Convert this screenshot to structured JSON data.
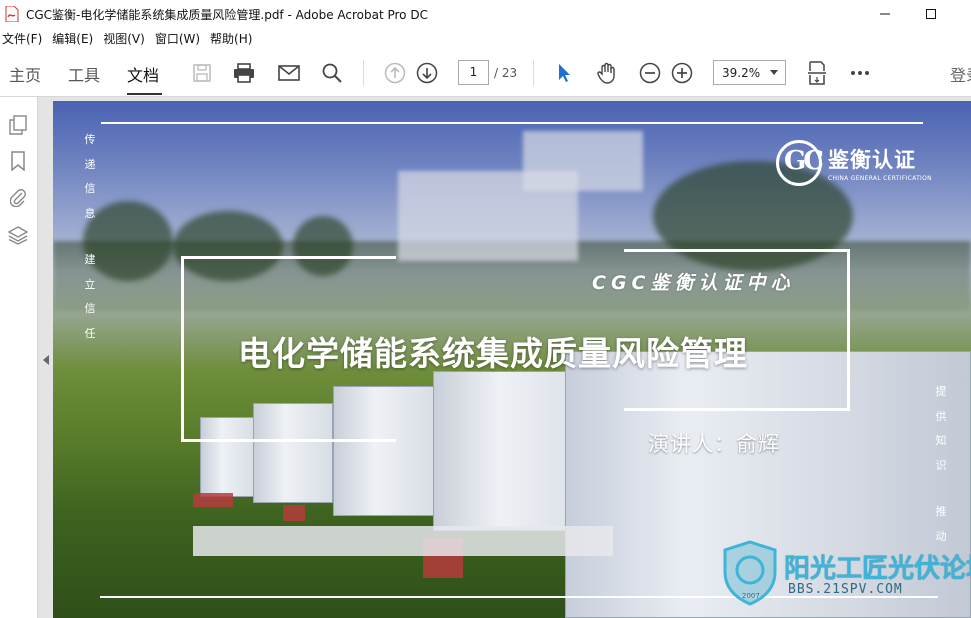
{
  "window": {
    "title": "CGC鉴衡-电化学储能系统集成质量风险管理.pdf - Adobe Acrobat Pro DC"
  },
  "menu": {
    "items": [
      "文件(F)",
      "编辑(E)",
      "视图(V)",
      "窗口(W)",
      "帮助(H)"
    ]
  },
  "toolbar": {
    "tabs": [
      "主页",
      "工具",
      "文档"
    ],
    "active_tab": "文档",
    "page_current": "1",
    "page_total": "/ 23",
    "zoom": "39.2%",
    "signin": "登录",
    "icons": [
      "save-icon",
      "print-icon",
      "email-icon",
      "search-icon",
      "page-up-icon",
      "page-down-icon",
      "select-cursor-icon",
      "hand-icon",
      "zoom-out-icon",
      "zoom-in-icon",
      "fit-page-icon",
      "more-icon"
    ]
  },
  "leftpane": {
    "icons": [
      "pages-icon",
      "bookmark-icon",
      "attachment-icon",
      "layers-icon"
    ]
  },
  "slide": {
    "left_vertical_1": "传递信息",
    "left_vertical_2": "建立信任",
    "right_vertical_1": "提供知识",
    "right_vertical_2": "推动",
    "org_name": "CGC鉴衡认证中心",
    "title": "电化学储能系统集成质量风险管理",
    "speaker": "演讲人：俞辉",
    "logo_cn": "鉴衡认证",
    "logo_en": "CHINA GENERAL CERTIFICATION",
    "watermark_main": "阳光工匠光伏论坛",
    "watermark_url": "BBS.21SPV.COM",
    "accent_color": "#4a62b2"
  }
}
